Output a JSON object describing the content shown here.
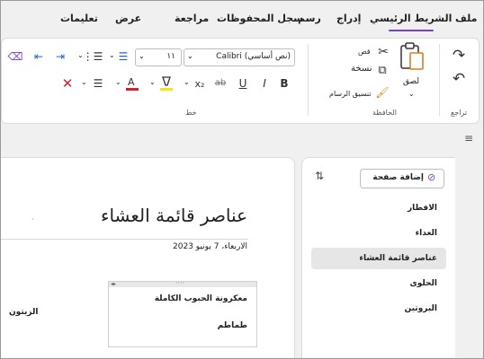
{
  "tabs": [
    {
      "label": "ملف"
    },
    {
      "label": "الشريط الرئيسي"
    },
    {
      "label": "إدراج"
    },
    {
      "label": "رسم"
    },
    {
      "label": "سجل المحفوظات"
    },
    {
      "label": "مراجعة"
    },
    {
      "label": "عرض"
    },
    {
      "label": "تعليمات"
    }
  ],
  "accent_color": "#7b3fbf",
  "ribbon": {
    "undo_group": {
      "label": "تراجع"
    },
    "clipboard": {
      "label": "الحافظة",
      "paste": "لصق",
      "cut": "قص",
      "copy": "نسخة",
      "format_painter": "تنسيق الرسام"
    },
    "font": {
      "label": "خط",
      "font_name": "Calibri (نص أساسي)",
      "font_size": "١١"
    }
  },
  "pages_panel": {
    "add_page": "إضافة صفحة",
    "pages": [
      {
        "title": "الافطار",
        "selected": false
      },
      {
        "title": "الغداء",
        "selected": false
      },
      {
        "title": "عناصر قائمة العشاء",
        "selected": true
      },
      {
        "title": "الحلوى",
        "selected": false
      },
      {
        "title": "البروتين",
        "selected": false
      }
    ]
  },
  "note": {
    "title": "عناصر قائمة العشاء",
    "date": "الاربعاء، 7 يونيو 2023",
    "container_lines": [
      "معكرونة الحبوب الكاملة",
      "طماطم"
    ],
    "partial_text": "الزيتون"
  }
}
